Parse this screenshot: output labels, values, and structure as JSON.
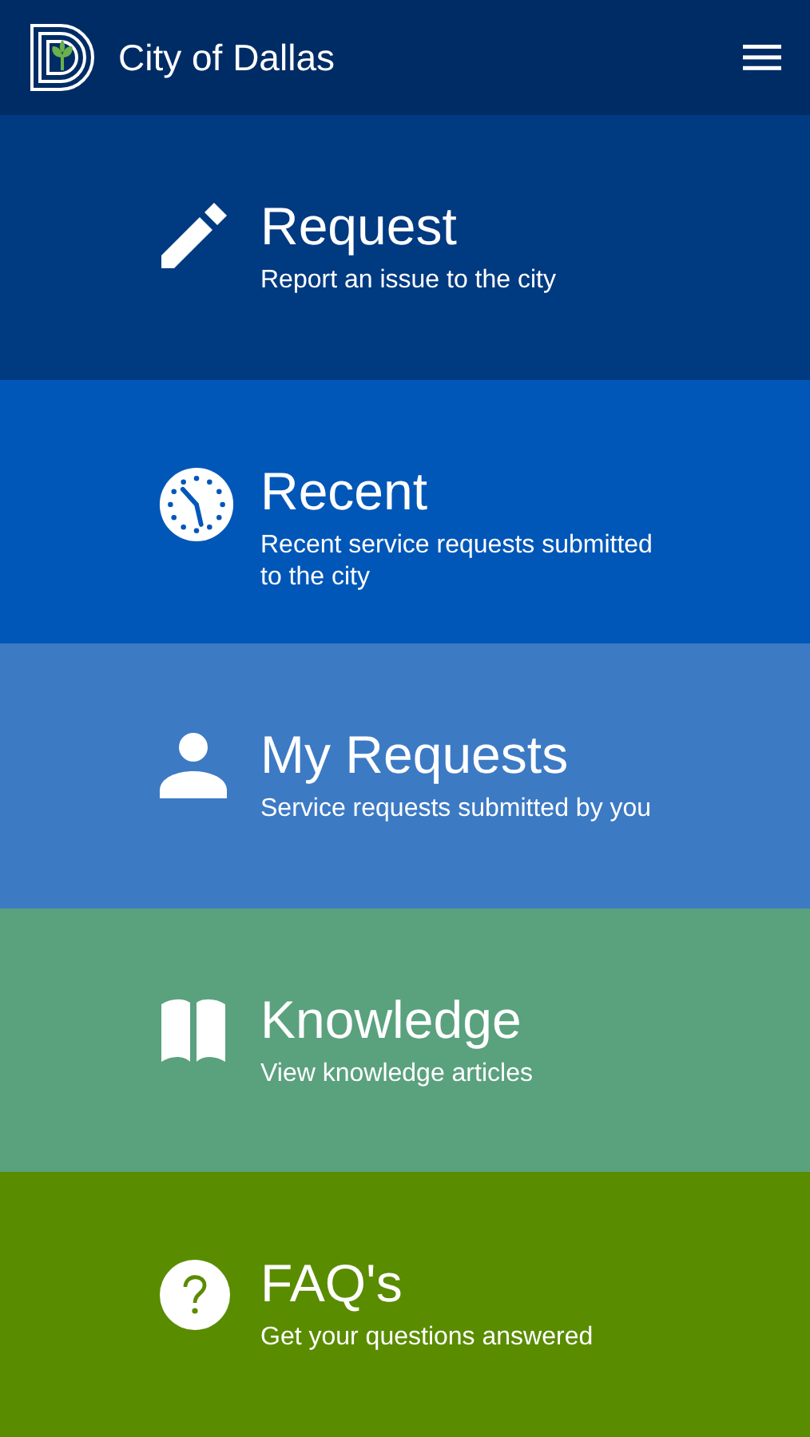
{
  "header": {
    "title": "City of Dallas"
  },
  "tiles": [
    {
      "kind": "pencil",
      "title": "Request",
      "subtitle": "Report an issue to the city",
      "color": "#003a80"
    },
    {
      "kind": "clock",
      "title": "Recent",
      "subtitle": "Recent service requests submitted to the city",
      "color": "#0057b8"
    },
    {
      "kind": "person",
      "title": "My Requests",
      "subtitle": "Service requests submitted by you",
      "color": "#3d7ac4"
    },
    {
      "kind": "book",
      "title": "Knowledge",
      "subtitle": "View knowledge articles",
      "color": "#5aa17e"
    },
    {
      "kind": "question",
      "title": "FAQ's",
      "subtitle": "Get your questions answered",
      "color": "#5a8c00"
    }
  ]
}
